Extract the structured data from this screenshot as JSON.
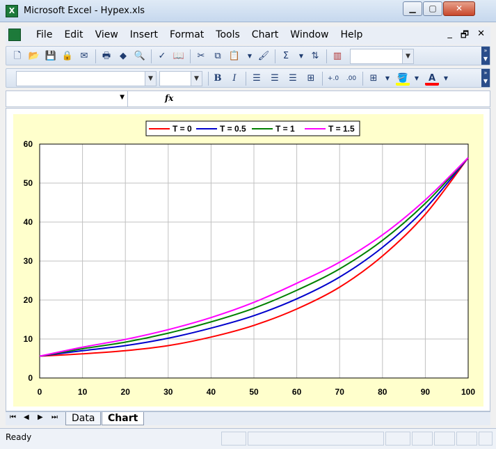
{
  "window": {
    "title": "Microsoft Excel - Hypex.xls",
    "app_icon_letter": "X",
    "minimize": "▁",
    "maximize": "▢",
    "close": "✕"
  },
  "menu": {
    "items": [
      "File",
      "Edit",
      "View",
      "Insert",
      "Format",
      "Tools",
      "Chart",
      "Window",
      "Help"
    ],
    "ctrl_min": "_",
    "ctrl_restore": "🗗",
    "ctrl_close": "✕"
  },
  "toolbar": {
    "sum_label": "Σ",
    "bold_label": "B",
    "italic_label": "I",
    "increase_decimal_label": "+.0",
    "decrease_decimal_label": ".00",
    "font_color_label": "A"
  },
  "formula_bar": {
    "fx_label": "fx",
    "value": ""
  },
  "sheet_tabs": {
    "nav": [
      "⏮",
      "◀",
      "▶",
      "⏭"
    ],
    "tabs": [
      {
        "label": "Data",
        "active": false
      },
      {
        "label": "Chart",
        "active": true
      }
    ]
  },
  "status": {
    "text": "Ready"
  },
  "colors": {
    "chart_background": "#ffffcc",
    "plot_background": "#ffffff",
    "gridline": "#c0c0c0",
    "t0": "#ff0000",
    "t05": "#0000cc",
    "t1": "#008000",
    "t15": "#ff00ff"
  },
  "chart_data": {
    "type": "line",
    "title": "",
    "xlabel": "",
    "ylabel": "",
    "xlim": [
      0,
      100
    ],
    "ylim": [
      0,
      60
    ],
    "xticks": [
      0,
      10,
      20,
      30,
      40,
      50,
      60,
      70,
      80,
      90,
      100
    ],
    "yticks": [
      0,
      10,
      20,
      30,
      40,
      50,
      60
    ],
    "grid": true,
    "legend_position": "top",
    "x": [
      0,
      10,
      20,
      30,
      40,
      50,
      60,
      70,
      80,
      90,
      100
    ],
    "series": [
      {
        "name": "T = 0",
        "color": "#ff0000",
        "values": [
          5.6,
          6.2,
          7.0,
          8.3,
          10.5,
          13.5,
          17.7,
          23.3,
          31.3,
          42.0,
          56.5
        ]
      },
      {
        "name": "T = 0.5",
        "color": "#0000cc",
        "values": [
          5.6,
          7.0,
          8.3,
          10.2,
          12.8,
          16.0,
          20.3,
          25.9,
          33.5,
          43.5,
          56.5
        ]
      },
      {
        "name": "T = 1",
        "color": "#008000",
        "values": [
          5.6,
          7.5,
          9.2,
          11.5,
          14.4,
          17.9,
          22.5,
          28.0,
          35.3,
          44.8,
          56.5
        ]
      },
      {
        "name": "T = 1.5",
        "color": "#ff00ff",
        "values": [
          5.6,
          7.9,
          9.9,
          12.4,
          15.5,
          19.4,
          24.3,
          29.7,
          36.7,
          45.7,
          56.5
        ]
      }
    ]
  }
}
